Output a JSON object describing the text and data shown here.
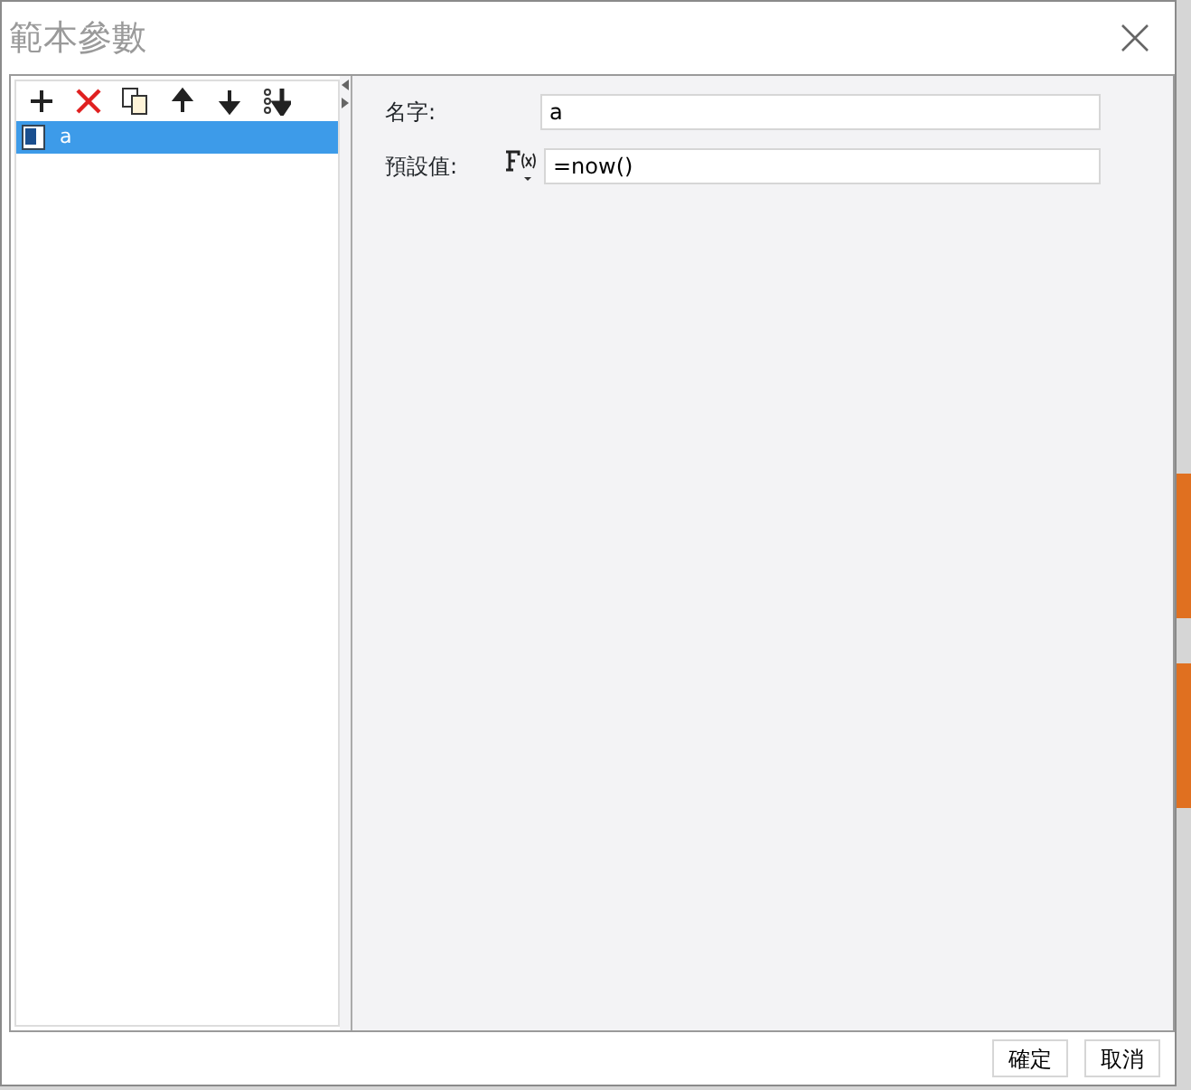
{
  "window": {
    "title": "範本參數"
  },
  "toolbar": [
    {
      "kind": "add"
    },
    {
      "kind": "delete"
    },
    {
      "kind": "copy"
    },
    {
      "kind": "up"
    },
    {
      "kind": "down"
    },
    {
      "kind": "sort"
    }
  ],
  "parameters": [
    {
      "name": "a",
      "selected": true
    }
  ],
  "fields": [
    {
      "label": "名字:",
      "value": "a",
      "kind": "text"
    },
    {
      "label": "預設值:",
      "value": "=now()",
      "kind": "formula"
    }
  ],
  "buttons": [
    "確定",
    "取消"
  ]
}
